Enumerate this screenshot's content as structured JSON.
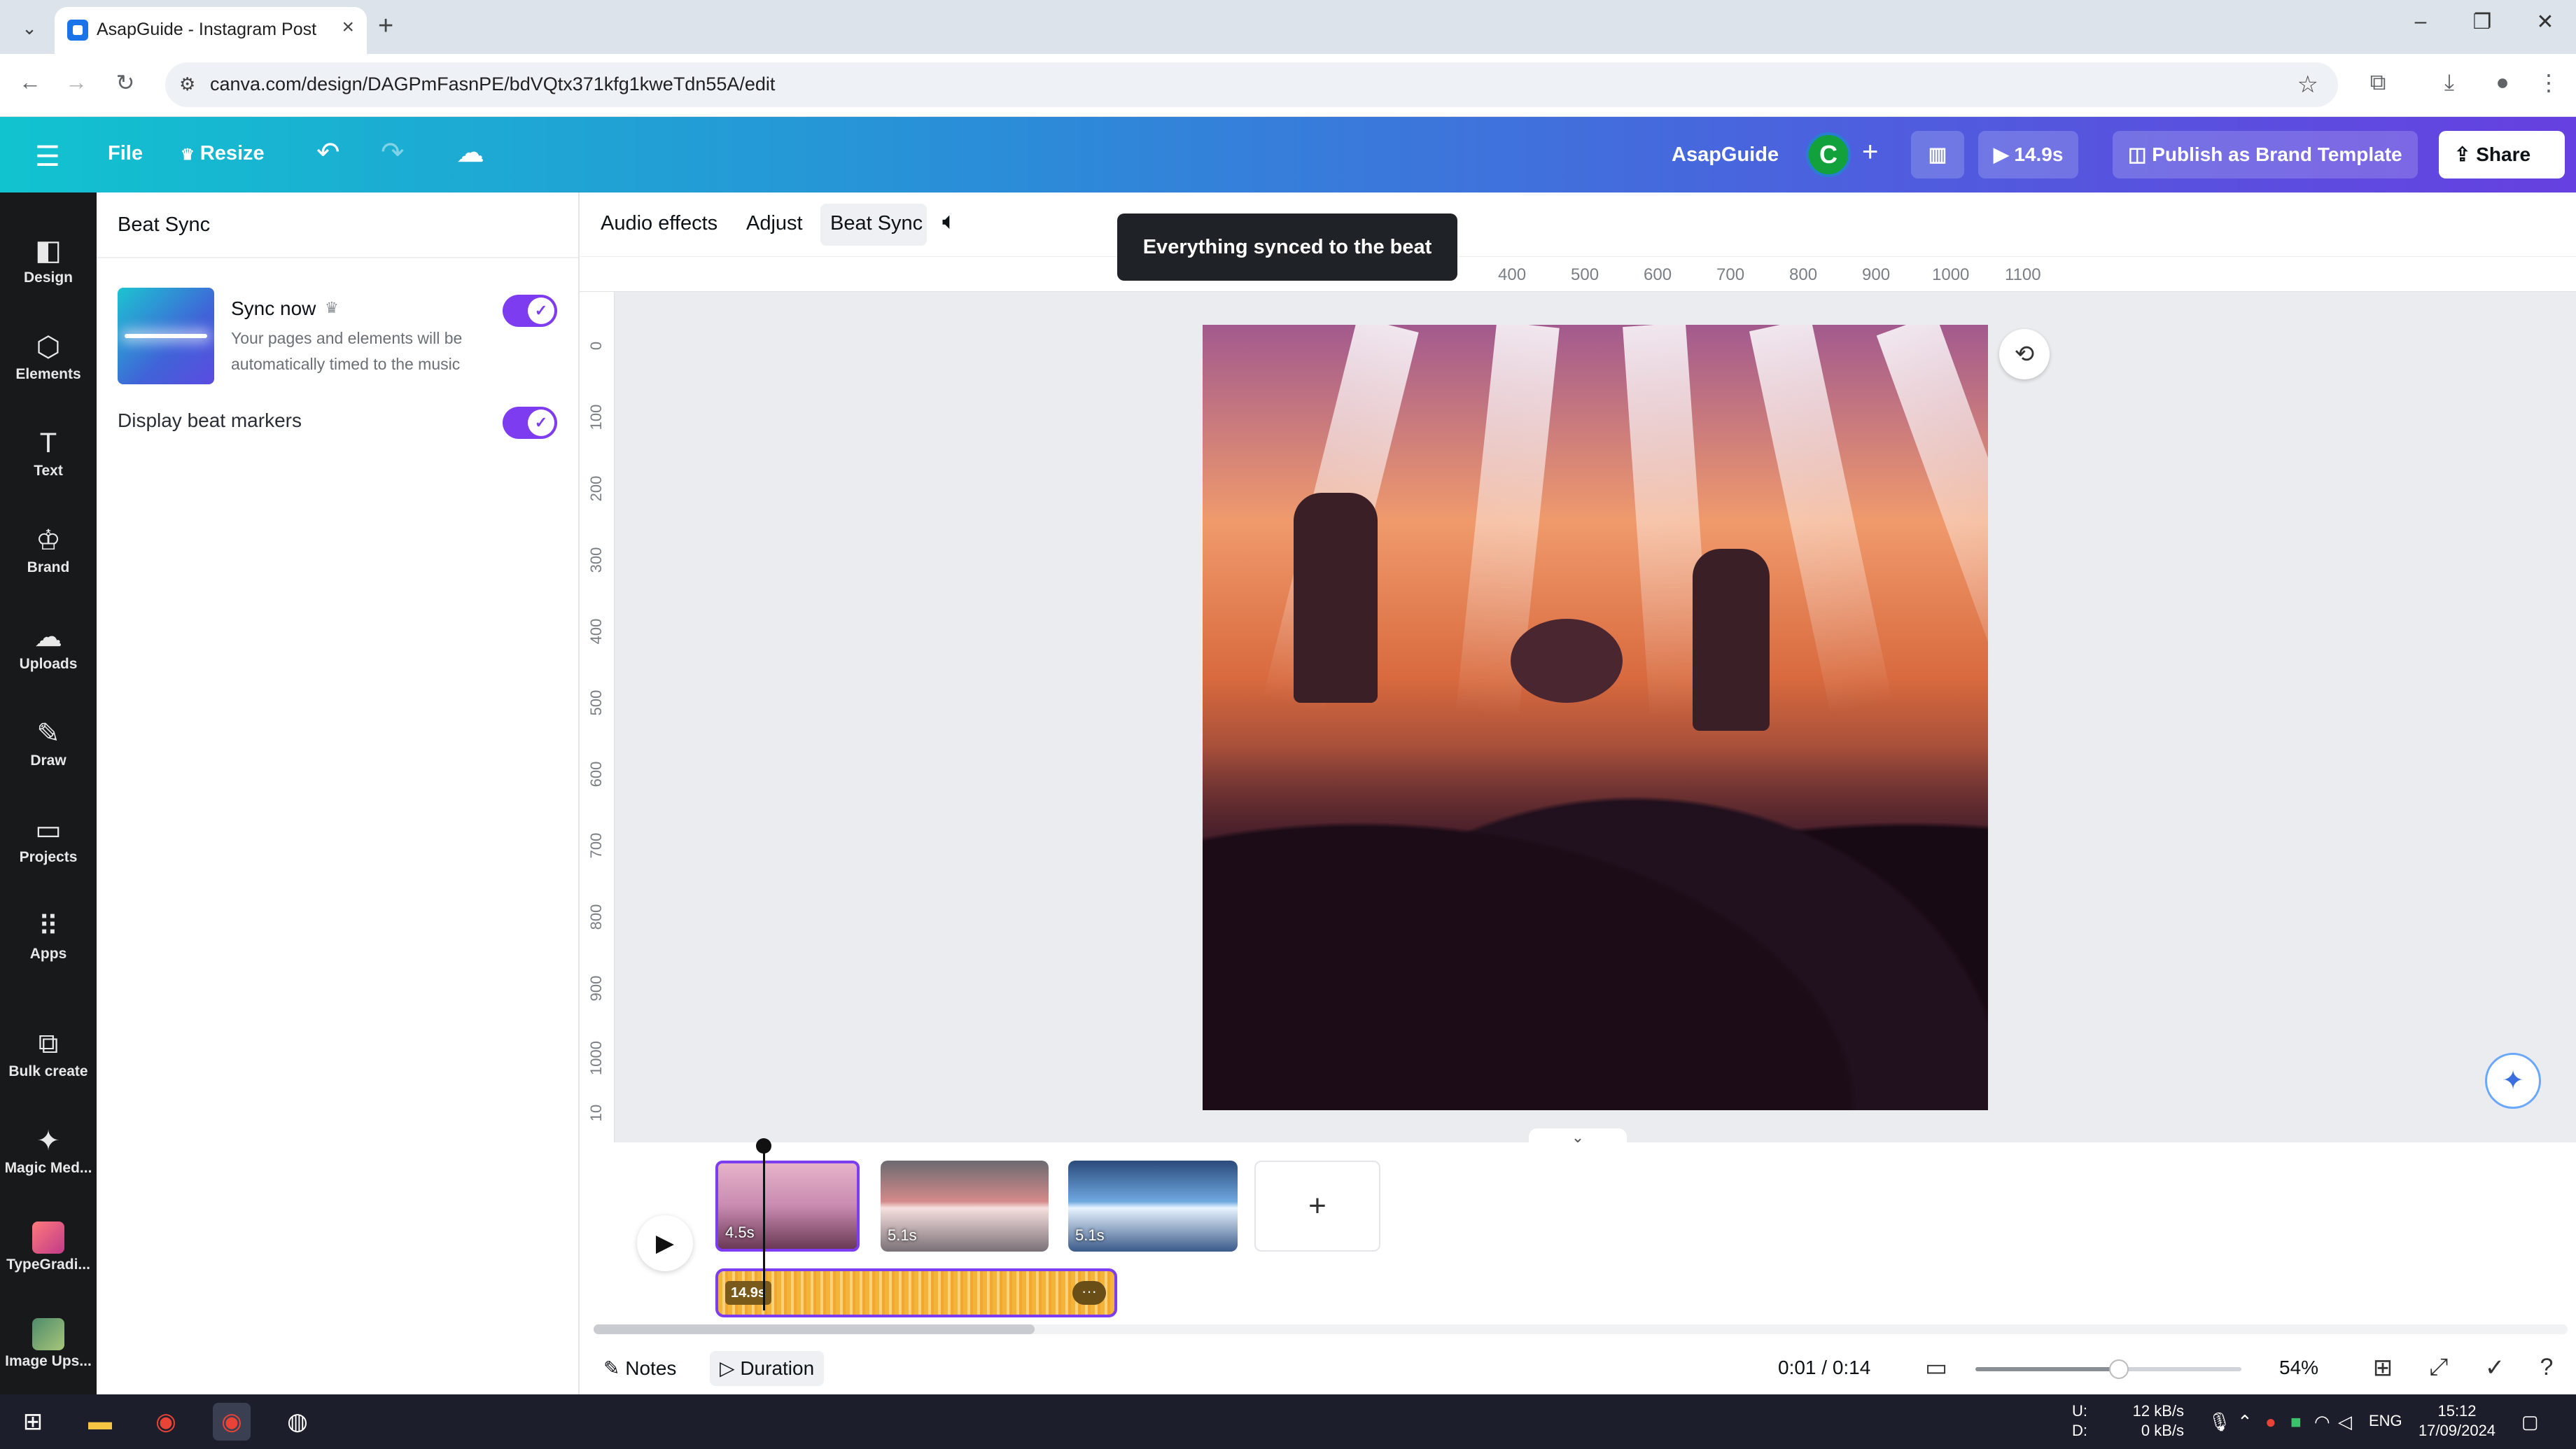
{
  "browser": {
    "tab_title": "AsapGuide - Instagram Post",
    "url": "canva.com/design/DAGPmFasnPE/bdVQtx371kfg1kweTdn55A/edit"
  },
  "header": {
    "file": "File",
    "resize": "Resize",
    "team_name": "AsapGuide",
    "avatar_initial": "C",
    "play_duration": "14.9s",
    "publish": "Publish as Brand Template",
    "share": "Share"
  },
  "sidebar": {
    "items": [
      {
        "label": "Design",
        "icon": "design-icon"
      },
      {
        "label": "Elements",
        "icon": "elements-icon"
      },
      {
        "label": "Text",
        "icon": "text-icon"
      },
      {
        "label": "Brand",
        "icon": "brand-icon"
      },
      {
        "label": "Uploads",
        "icon": "uploads-icon"
      },
      {
        "label": "Draw",
        "icon": "draw-icon"
      },
      {
        "label": "Projects",
        "icon": "projects-icon"
      },
      {
        "label": "Apps",
        "icon": "apps-icon"
      },
      {
        "label": "Bulk create",
        "icon": "bulk-create-icon"
      },
      {
        "label": "Magic Med...",
        "icon": "magic-media-icon"
      },
      {
        "label": "TypeGradi...",
        "icon": "typegradient-app-icon"
      },
      {
        "label": "Image Ups...",
        "icon": "image-upscaler-app-icon"
      }
    ]
  },
  "panel": {
    "title": "Beat Sync",
    "sync_title": "Sync now",
    "sync_desc": "Your pages and elements will be automatically timed to the music",
    "sync_enabled": true,
    "markers_label": "Display beat markers",
    "markers_enabled": true
  },
  "toolbar": {
    "audio_effects": "Audio effects",
    "adjust": "Adjust",
    "beat_sync": "Beat Sync"
  },
  "toast": "Everything synced to the beat",
  "rulers": {
    "top": [
      "400",
      "500",
      "600",
      "700",
      "800",
      "900",
      "1000",
      "1100"
    ],
    "left": [
      "0",
      "100",
      "200",
      "300",
      "400",
      "500",
      "600",
      "700",
      "800",
      "900",
      "1000",
      "10"
    ]
  },
  "timeline": {
    "clips": [
      {
        "duration": "4.5s"
      },
      {
        "duration": "5.1s"
      },
      {
        "duration": "5.1s"
      }
    ],
    "audio_duration": "14.9s"
  },
  "statusbar": {
    "notes": "Notes",
    "duration": "Duration",
    "time": "0:01 / 0:14",
    "zoom": "54%",
    "zoom_value": 0.54
  },
  "taskbar": {
    "net_up_label": "U:",
    "net_down_label": "D:",
    "net_up": "12 kB/s",
    "net_down": "0 kB/s",
    "lang": "ENG",
    "clock_time": "15:12",
    "clock_date": "17/09/2024"
  },
  "colors": {
    "accent_purple": "#7d3cf0",
    "header_start": "#11c3cf",
    "header_end": "#6640e0",
    "audio_track": "#f4b43a"
  }
}
